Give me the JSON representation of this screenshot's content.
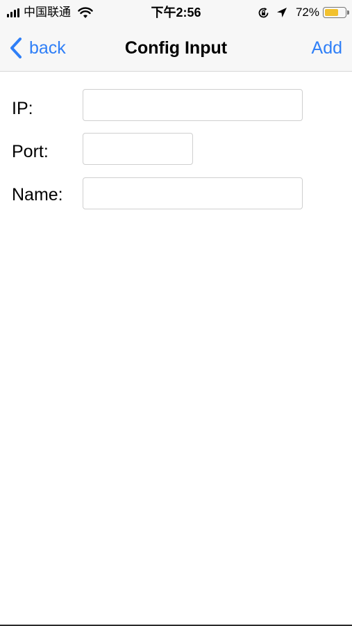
{
  "status_bar": {
    "carrier": "中国联通",
    "time": "下午2:56",
    "battery_percent": "72%",
    "battery_level": 0.72,
    "icons": [
      "signal-bars-icon",
      "wifi-icon",
      "rotation-lock-icon",
      "location-arrow-icon",
      "battery-icon"
    ]
  },
  "nav": {
    "back_label": "back",
    "title": "Config Input",
    "add_label": "Add"
  },
  "form": {
    "ip": {
      "label": "IP:",
      "value": "",
      "placeholder": ""
    },
    "port": {
      "label": "Port:",
      "value": "",
      "placeholder": ""
    },
    "name": {
      "label": "Name:",
      "value": "",
      "placeholder": ""
    }
  },
  "colors": {
    "accent": "#2f7ff7",
    "battery": "#f2c12e",
    "bar_background": "#f7f7f7"
  }
}
